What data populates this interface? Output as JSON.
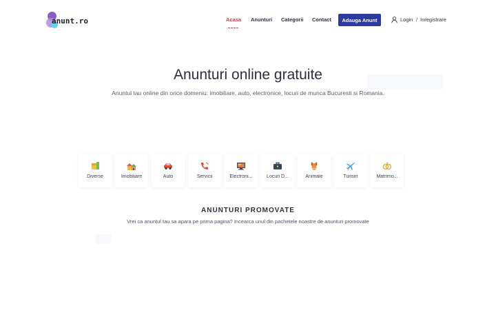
{
  "header": {
    "logo_text": "anunt.ro",
    "nav": {
      "home": "Acasa",
      "ads": "Anunturi",
      "categories": "Categorii",
      "contact": "Contact"
    },
    "add_button": "Adauga Anunt",
    "login": "Login",
    "separator": "/",
    "register": "Inregistrare",
    "active_color": "#c13c4b",
    "button_color": "#2e3a9e"
  },
  "hero": {
    "title": "Anunturi online gratuite",
    "subtitle": "Anuntul tau online din orice domeniu: imobiliare, auto, electronice, locuri de munca Bucuresti si Romania."
  },
  "categories": [
    {
      "label": "Diverse",
      "icon": "box-icon"
    },
    {
      "label": "Imobiliare",
      "icon": "houses-icon"
    },
    {
      "label": "Auto",
      "icon": "car-icon"
    },
    {
      "label": "Servicii",
      "icon": "phone-icon"
    },
    {
      "label": "Electroni...",
      "icon": "computer-icon"
    },
    {
      "label": "Locuri D...",
      "icon": "briefcase-icon"
    },
    {
      "label": "Animale",
      "icon": "dog-icon"
    },
    {
      "label": "Turism",
      "icon": "airplane-icon"
    },
    {
      "label": "Matrimo...",
      "icon": "rings-icon"
    }
  ],
  "promoted": {
    "title": "ANUNTURI PROMOVATE",
    "subtitle": "Vrei ca anuntul tau sa apara pe prima pagina? Incearca unul din pachetele noastre de anunturi promovate"
  }
}
